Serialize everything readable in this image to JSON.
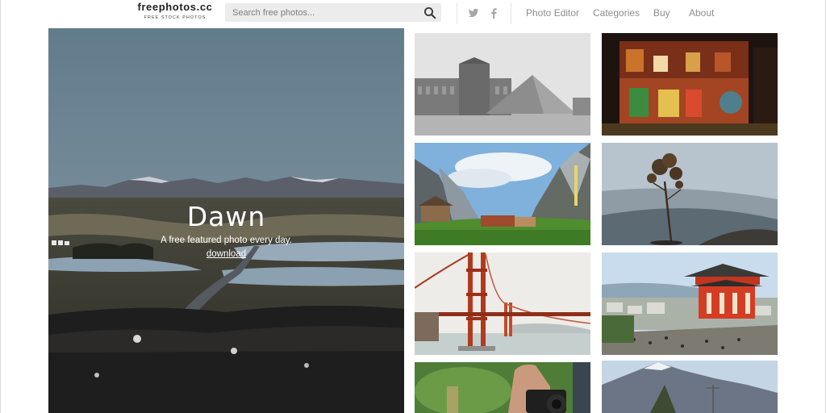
{
  "brand": {
    "name": "freephotos.cc",
    "tagline": "FREE STOCK PHOTOS"
  },
  "search": {
    "placeholder": "Search free photos...",
    "value": "",
    "icon": "magnifier-icon"
  },
  "social": [
    {
      "name": "twitter",
      "icon": "twitter-icon"
    },
    {
      "name": "facebook",
      "icon": "facebook-icon"
    }
  ],
  "nav": {
    "photo_editor": "Photo Editor",
    "categories": "Categories",
    "buy": "Buy",
    "about": "About"
  },
  "hero": {
    "title": "Dawn",
    "subtitle": "A free featured photo every day.",
    "link": "download"
  },
  "photos": [
    {
      "subject": "louvre-pyramid",
      "tone": "black-and-white"
    },
    {
      "subject": "colorful-building-night",
      "tone": "warm"
    },
    {
      "subject": "mountain-valley",
      "tone": "green-blue"
    },
    {
      "subject": "tree-on-beach",
      "tone": "muted"
    },
    {
      "subject": "golden-gate-bridge",
      "tone": "foggy"
    },
    {
      "subject": "japanese-temple",
      "tone": "vivid"
    },
    {
      "subject": "camera-in-hands",
      "tone": "green"
    },
    {
      "subject": "snowy-mountain",
      "tone": "cool"
    }
  ],
  "colors": {
    "nav_text": "#8e8e8e",
    "search_bg": "#ececec",
    "logo_text": "#222222"
  }
}
